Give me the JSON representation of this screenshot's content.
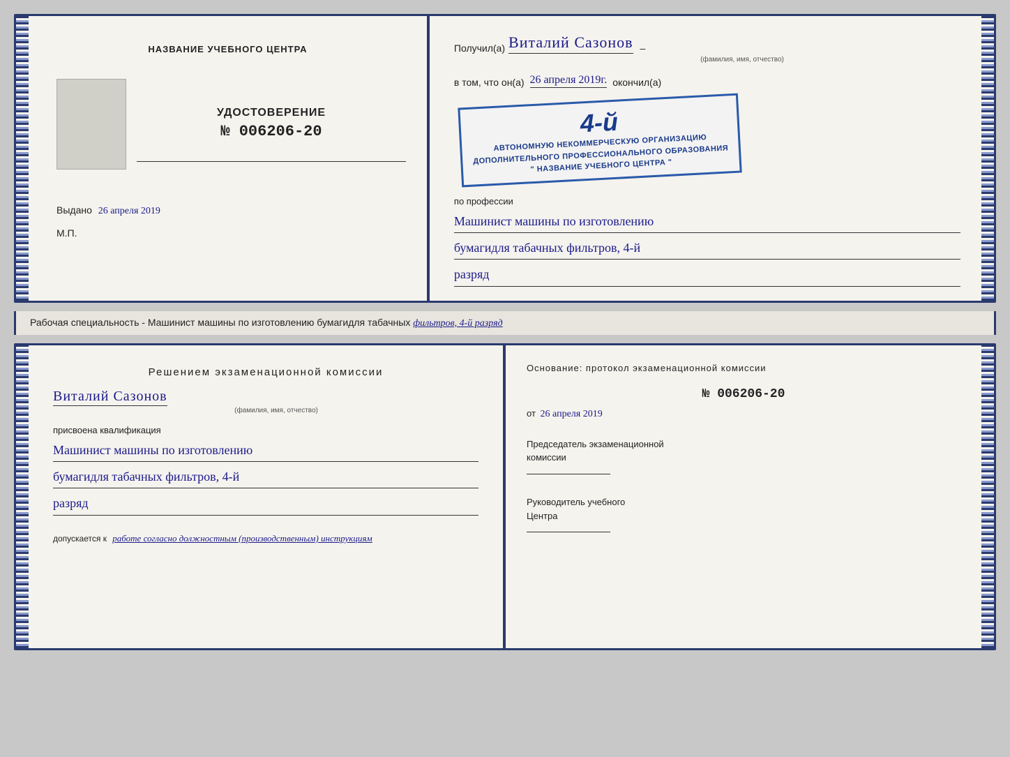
{
  "page": {
    "background_color": "#c8c8c8"
  },
  "top_booklet": {
    "left": {
      "center_title": "НАЗВАНИЕ УЧЕБНОГО ЦЕНТРА",
      "udostoverenie_label": "УДОСТОВЕРЕНИЕ",
      "udostoverenie_number": "№ 006206-20",
      "vydano_label": "Выдано",
      "vydano_date": "26 апреля 2019",
      "mp_label": "М.П."
    },
    "right": {
      "poluchil_prefix": "Получил(а)",
      "recipient_name": "Виталий Сазонов",
      "name_subtitle": "(фамилия, имя, отчество)",
      "dash": "–",
      "vtom_prefix": "в том, что он(а)",
      "vtom_date": "26 апреля 2019г.",
      "okonchil": "окончил(а)",
      "stamp_number": "4-й",
      "stamp_line1": "АВТОНОМНУЮ НЕКОММЕРЧЕСКУЮ ОРГАНИЗАЦИЮ",
      "stamp_line2": "ДОПОЛНИТЕЛЬНОГО ПРОФЕССИОНАЛЬНОГО ОБРАЗОВАНИЯ",
      "stamp_line3": "\" НАЗВАНИЕ УЧЕБНОГО ЦЕНТРА \"",
      "po_professii": "по профессии",
      "profession_line1": "Машинист машины по изготовлению",
      "profession_line2": "бумагидля табачных фильтров, 4-й",
      "profession_line3": "разряд"
    }
  },
  "middle_text": {
    "text": "Рабочая специальность - Машинист машины по изготовлению бумагидля табачных фильтров, 4-й разряд"
  },
  "bottom_booklet": {
    "left": {
      "resheniem_title": "Решением экзаменационной комиссии",
      "recipient_name": "Виталий Сазонов",
      "name_subtitle": "(фамилия, имя, отчество)",
      "prisvoena_label": "присвоена квалификация",
      "qualification_line1": "Машинист машины по изготовлению",
      "qualification_line2": "бумагидля табачных фильтров, 4-й",
      "qualification_line3": "разряд",
      "dopuskaetsya_prefix": "допускается к",
      "dopuskaetsya_value": "работе согласно должностным (производственным) инструкциям"
    },
    "right": {
      "osnovanie_label": "Основание: протокол экзаменационной комиссии",
      "protokol_number": "№ 006206-20",
      "ot_prefix": "от",
      "ot_date": "26 апреля 2019",
      "predsedatel_line1": "Председатель экзаменационной",
      "predsedatel_line2": "комиссии",
      "rukovoditel_line1": "Руководитель учебного",
      "rukovoditel_line2": "Центра"
    }
  }
}
